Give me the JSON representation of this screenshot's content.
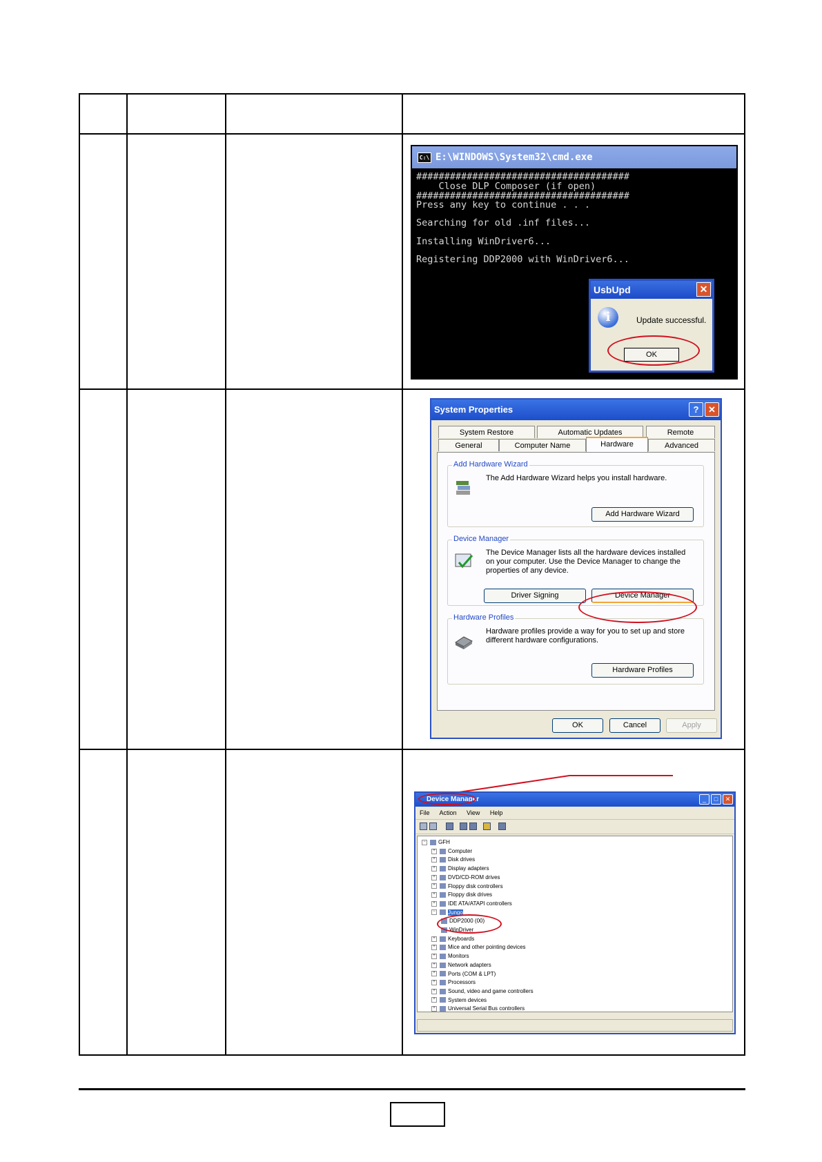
{
  "cmd_window": {
    "title": "E:\\WINDOWS\\System32\\cmd.exe",
    "icon_text": "C:\\",
    "lines": [
      "######################################",
      "    Close DLP Composer (if open)",
      "######################################",
      "Press any key to continue . . .",
      "Searching for old .inf files...",
      "Installing WinDriver6...",
      "Registering DDP2000 with WinDriver6..."
    ],
    "dialog": {
      "title": "UsbUpd",
      "close": "✕",
      "info_glyph": "i",
      "message": "Update successful.",
      "ok_label": "OK"
    }
  },
  "system_properties": {
    "title": "System Properties",
    "help": "?",
    "close": "✕",
    "tabs_back": [
      "System Restore",
      "Automatic Updates",
      "Remote"
    ],
    "tabs_front": [
      "General",
      "Computer Name",
      "Hardware",
      "Advanced"
    ],
    "active_tab": "Hardware",
    "groups": {
      "add_hardware": {
        "label": "Add Hardware Wizard",
        "text": "The Add Hardware Wizard helps you install hardware.",
        "button": "Add Hardware Wizard"
      },
      "device_manager": {
        "label": "Device Manager",
        "text": "The Device Manager lists all the hardware devices installed on your computer. Use the Device Manager to change the properties of any device.",
        "button_signing": "Driver Signing",
        "button": "Device Manager"
      },
      "hardware_profiles": {
        "label": "Hardware Profiles",
        "text": "Hardware profiles provide a way for you to set up and store different hardware configurations.",
        "button": "Hardware Profiles"
      }
    },
    "buttons": {
      "ok": "OK",
      "cancel": "Cancel",
      "apply": "Apply"
    }
  },
  "device_manager": {
    "title": "Device Manager",
    "menu": "File Action View Help",
    "tree": [
      {
        "label": "GFH",
        "level": 0,
        "box": "−"
      },
      {
        "label": "Computer",
        "level": 1,
        "box": "+"
      },
      {
        "label": "Disk drives",
        "level": 1,
        "box": "+"
      },
      {
        "label": "Display adapters",
        "level": 1,
        "box": "+"
      },
      {
        "label": "DVD/CD-ROM drives",
        "level": 1,
        "box": "+"
      },
      {
        "label": "Floppy disk controllers",
        "level": 1,
        "box": "+"
      },
      {
        "label": "Floppy disk drives",
        "level": 1,
        "box": "+"
      },
      {
        "label": "IDE ATA/ATAPI controllers",
        "level": 1,
        "box": "+"
      },
      {
        "label": "Jungo",
        "level": 1,
        "box": "−"
      },
      {
        "label": "DDP2000 (00)",
        "level": 2,
        "box": ""
      },
      {
        "label": "WinDriver",
        "level": 2,
        "box": ""
      },
      {
        "label": "Keyboards",
        "level": 1,
        "box": "+"
      },
      {
        "label": "Mice and other pointing devices",
        "level": 1,
        "box": "+"
      },
      {
        "label": "Monitors",
        "level": 1,
        "box": "+"
      },
      {
        "label": "Network adapters",
        "level": 1,
        "box": "+"
      },
      {
        "label": "Ports (COM & LPT)",
        "level": 1,
        "box": "+"
      },
      {
        "label": "Processors",
        "level": 1,
        "box": "+"
      },
      {
        "label": "Sound, video and game controllers",
        "level": 1,
        "box": "+"
      },
      {
        "label": "System devices",
        "level": 1,
        "box": "+"
      },
      {
        "label": "Universal Serial Bus controllers",
        "level": 1,
        "box": "+"
      }
    ]
  },
  "colors": {
    "highlight": "#d01020",
    "xp_blue": "#1c4ecb"
  }
}
